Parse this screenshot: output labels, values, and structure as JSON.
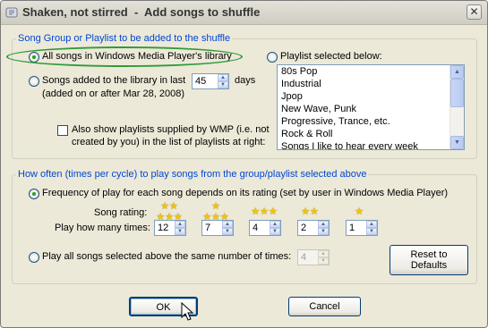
{
  "window": {
    "title": "Shaken, not stirred  -  Add songs to shuffle",
    "close_glyph": "✕"
  },
  "group1": {
    "legend": "Song Group or Playlist to be added to the shuffle",
    "all_songs_label": "All songs in Windows Media Player's library",
    "recent_label_pre": "Songs added to the library in last",
    "recent_days_value": "45",
    "recent_label_post": "days",
    "recent_date_note": "(added on or after Mar 28, 2008)",
    "wmp_checkbox_line1": "Also show playlists supplied by WMP (i.e. not",
    "wmp_checkbox_line2": "created by you) in the list of playlists at right:",
    "playlist_radio_label": "Playlist selected below:",
    "playlists": [
      "80s Pop",
      "Industrial",
      "Jpop",
      "New Wave, Punk",
      "Progressive, Trance, etc.",
      "Rock & Roll",
      "Songs I like to hear every week"
    ]
  },
  "group2": {
    "legend": "How often (times per cycle) to play songs from the group/playlist selected above",
    "rating_radio_label": "Frequency of play for each song depends on its rating (set by user in Windows Media Player)",
    "song_rating_label": "Song rating:",
    "play_times_label": "Play how many times:",
    "ratings": [
      {
        "stars": 5,
        "times": "12"
      },
      {
        "stars": 4,
        "times": "7"
      },
      {
        "stars": 3,
        "times": "4"
      },
      {
        "stars": 2,
        "times": "2"
      },
      {
        "stars": 1,
        "times": "1"
      }
    ],
    "same_radio_label": "Play all songs selected above the same number of times:",
    "same_times_value": "4",
    "reset_line1": "Reset to",
    "reset_line2": "Defaults"
  },
  "buttons": {
    "ok": "OK",
    "cancel": "Cancel"
  },
  "colors": {
    "legend": "#0046d5",
    "highlight_ring": "#2e9b3a",
    "star": "#f1c40f"
  }
}
